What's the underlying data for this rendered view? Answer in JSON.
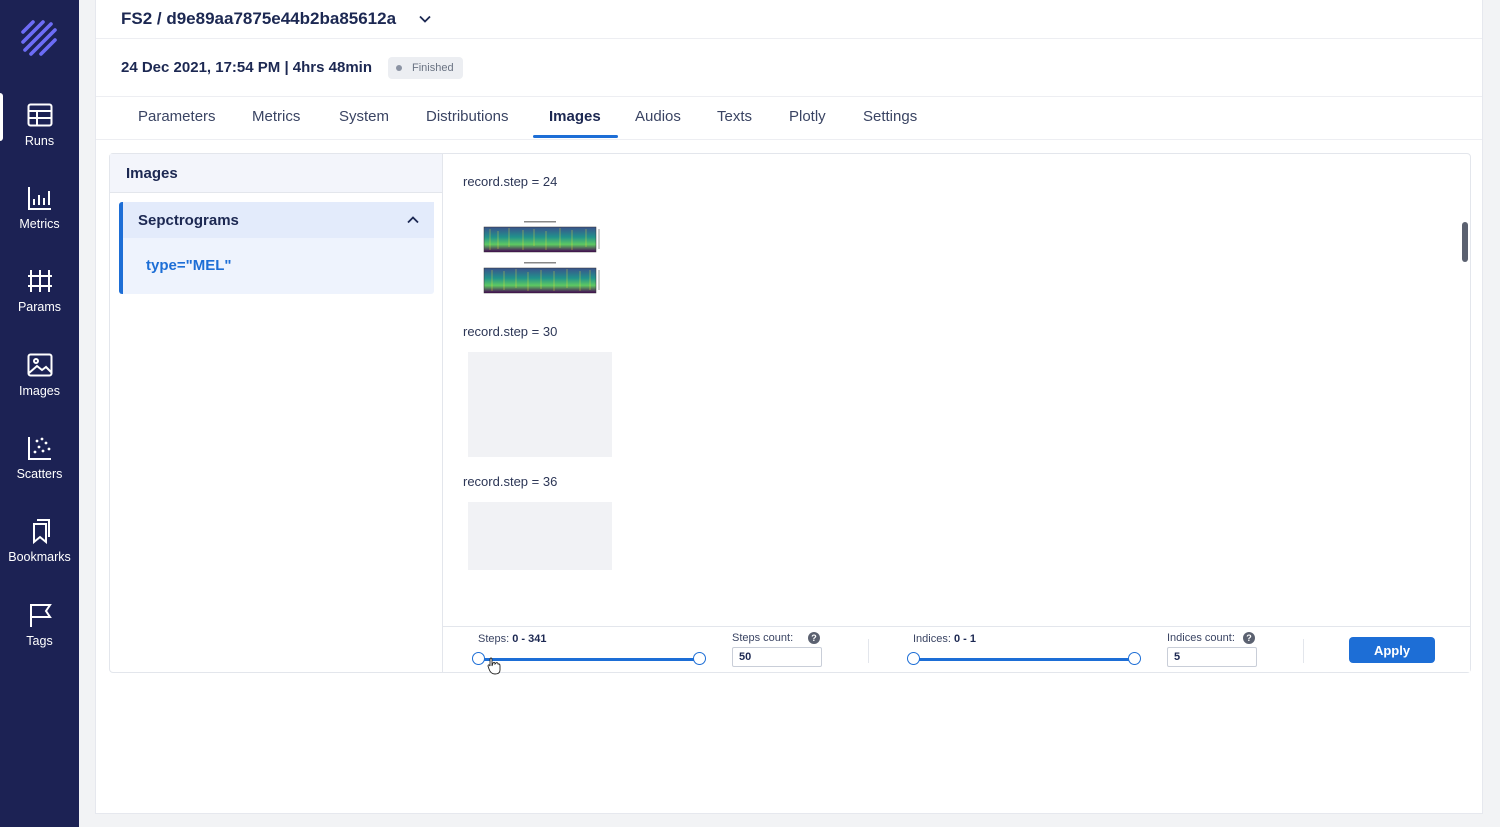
{
  "sidebar": {
    "items": [
      {
        "label": "Runs",
        "icon": "table-icon",
        "active": true
      },
      {
        "label": "Metrics",
        "icon": "chart-icon"
      },
      {
        "label": "Params",
        "icon": "params-icon"
      },
      {
        "label": "Images",
        "icon": "image-icon"
      },
      {
        "label": "Scatters",
        "icon": "scatter-icon"
      },
      {
        "label": "Bookmarks",
        "icon": "bookmark-icon"
      },
      {
        "label": "Tags",
        "icon": "flag-icon"
      }
    ]
  },
  "header": {
    "run_title": "FS2 / d9e89aa7875e44b2ba85612a",
    "meta": "24 Dec 2021, 17:54 PM | 4hrs 48min",
    "status": "Finished"
  },
  "tabs": [
    "Parameters",
    "Metrics",
    "System",
    "Distributions",
    "Images",
    "Audios",
    "Texts",
    "Plotly",
    "Settings"
  ],
  "active_tab": "Images",
  "images_panel": {
    "title": "Images",
    "group_name": "Sepctrograms",
    "group_item": "type=\"MEL\""
  },
  "records": [
    {
      "label": "record.step = 24"
    },
    {
      "label": "record.step = 30"
    },
    {
      "label": "record.step = 36"
    }
  ],
  "controls": {
    "steps_label": "Steps:",
    "steps_range": "0 - 341",
    "steps_count_label": "Steps count:",
    "steps_count_value": "50",
    "indices_label": "Indices:",
    "indices_range": "0 - 1",
    "indices_count_label": "Indices count:",
    "indices_count_value": "5",
    "help_glyph": "?",
    "apply_label": "Apply"
  },
  "colors": {
    "sidebar_bg": "#1c2254",
    "accent": "#1d6ed6"
  }
}
